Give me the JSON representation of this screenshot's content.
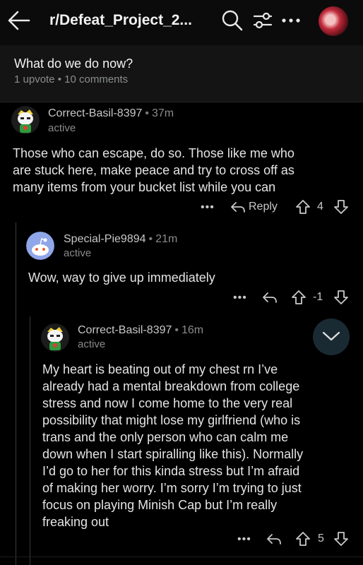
{
  "header": {
    "subreddit": "r/Defeat_Project_2...",
    "icons": [
      "back-arrow-icon",
      "search-icon",
      "filter-icon",
      "more-icon",
      "avatar"
    ]
  },
  "post": {
    "title": "What do we do now?",
    "meta": "1 upvote • 10 comments"
  },
  "comments": [
    {
      "username": "Correct-Basil-8397",
      "time": "37m",
      "status": "active",
      "text_lines": [
        "Those who can escape, do so. Those like me who",
        "are stuck here, make peace and try to cross off as",
        "many items from your bucket list while you can"
      ],
      "actions": {
        "more": "•••",
        "reply": "Reply",
        "votes": "4"
      }
    },
    {
      "username": "Special-Pie9894",
      "time": "21m",
      "status": "active",
      "text_lines": [
        "Wow, way to give up immediately"
      ],
      "actions": {
        "more": "•••",
        "votes": "-1"
      }
    },
    {
      "username": "Correct-Basil-8397",
      "time": "16m",
      "status": "active",
      "text_lines": [
        "My heart is beating out of my chest rn I’ve",
        "already had a mental breakdown from college",
        "stress and now I come home to the very real",
        "possibility that might lose my girlfriend (who is",
        "trans and the only person who can calm me",
        "down when I start spiralling like this). Normally",
        "I’d go to her for this kinda stress but I’m afraid",
        "of making her worry. I’m sorry I’m trying to just",
        "focus on playing Minish Cap but I’m really",
        "freaking out"
      ],
      "actions": {
        "more": "•••",
        "votes": "5"
      }
    }
  ],
  "colors": {
    "background": "#000000",
    "header": "#141414",
    "text": "#e4e4e4",
    "muted": "#8a8a8a",
    "fab": "#1a2a33"
  }
}
